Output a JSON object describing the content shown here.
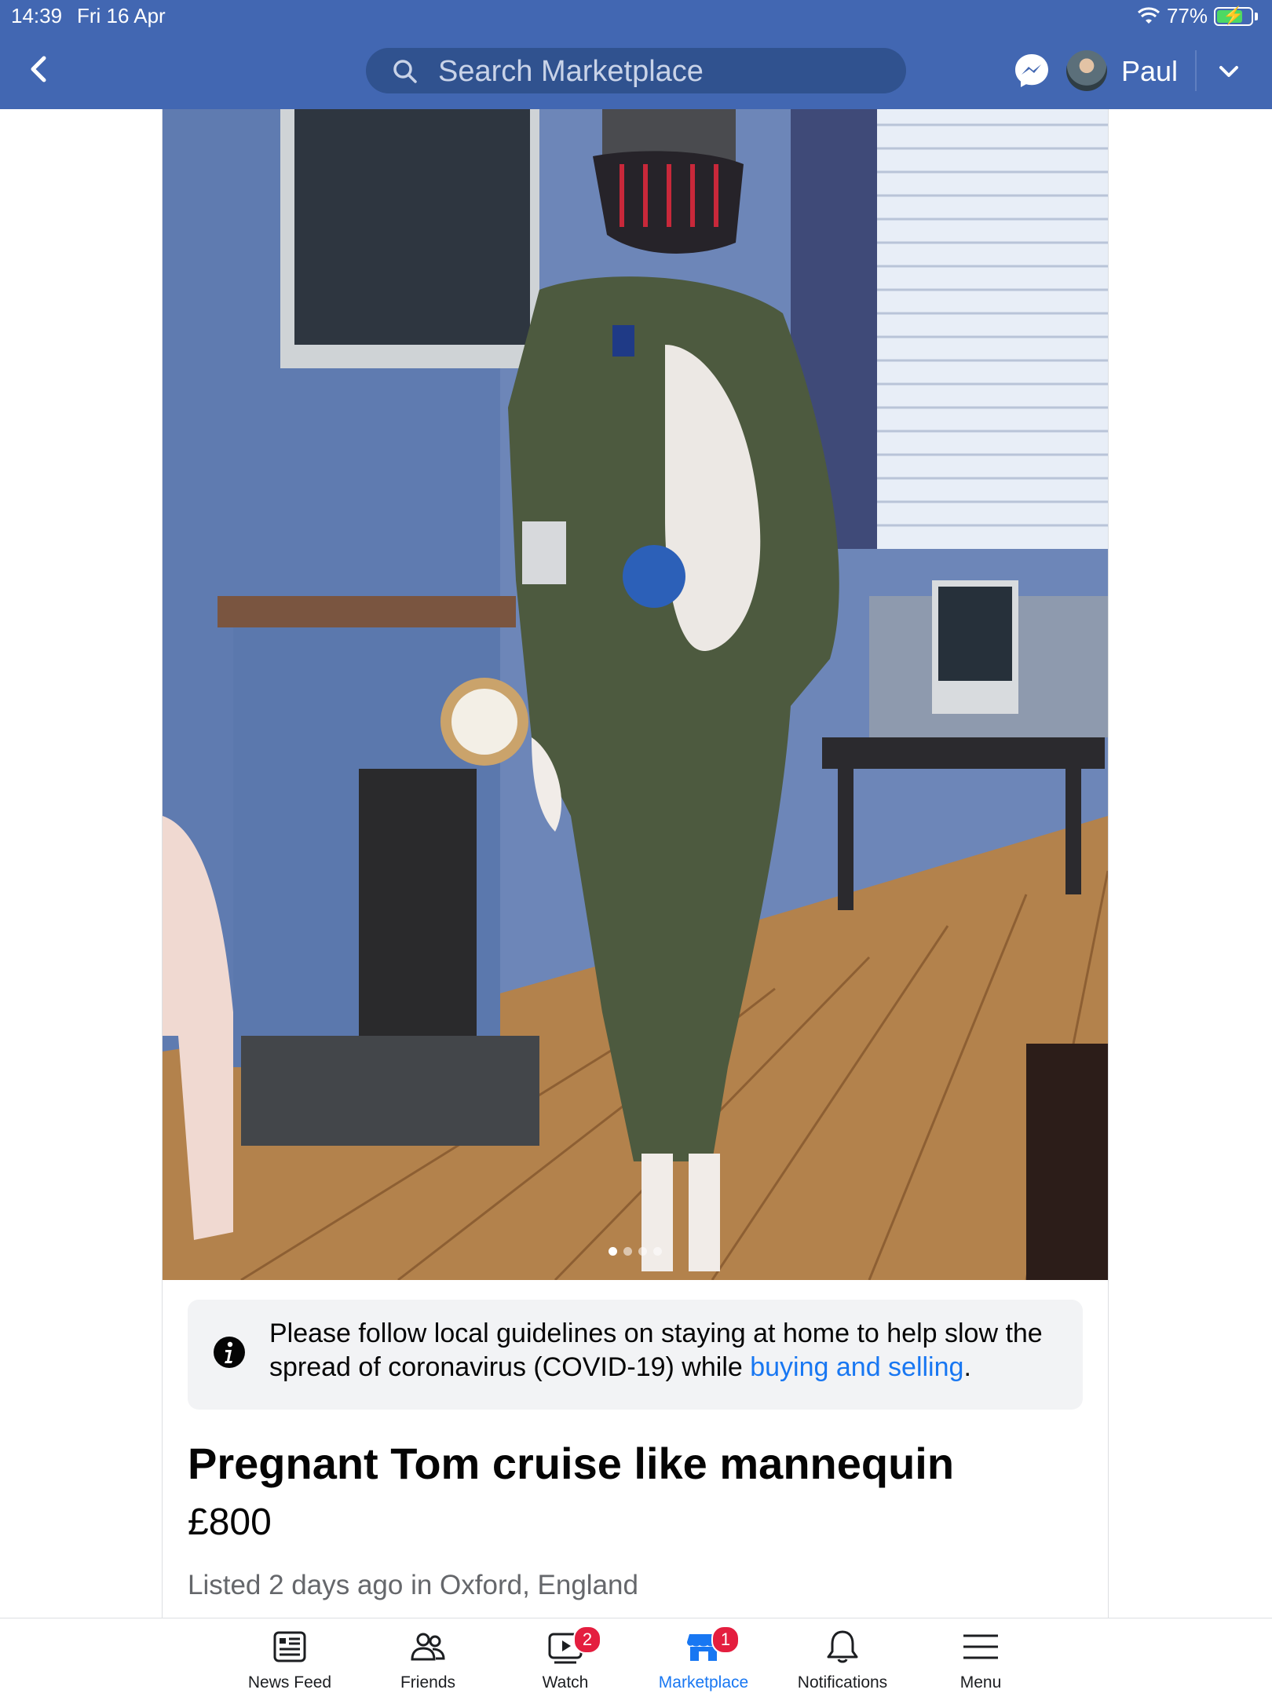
{
  "status_bar": {
    "time": "14:39",
    "date": "Fri 16 Apr",
    "battery": "77%",
    "battery_level": 0.77,
    "battery_color": "#4cd964"
  },
  "header": {
    "background_color": "#4267b2",
    "back_icon": "chevron-left-icon",
    "search": {
      "placeholder": "Search Marketplace",
      "value": "",
      "icon": "search-icon"
    },
    "messenger_icon": "messenger-icon",
    "user_name": "Paul",
    "account_menu_icon": "chevron-down-icon"
  },
  "listing": {
    "photo": {
      "description_icon": "listing-photo",
      "total_photos": 4,
      "current_photo": 1
    },
    "notice": {
      "icon": "info-icon",
      "text": "Please follow local guidelines on staying at home to help slow the spread of coronavirus (COVID-19) while ",
      "link": "buying and selling",
      "trailing": "."
    },
    "title": "Pregnant Tom cruise like mannequin",
    "price": "£800",
    "listed": "Listed 2 days ago in Oxford, England"
  },
  "tabbar": {
    "active_color": "#1877f2",
    "badge_color": "#e41e3f",
    "tabs": [
      {
        "label": "News Feed",
        "icon": "news-feed-icon"
      },
      {
        "label": "Friends",
        "icon": "friends-icon"
      },
      {
        "label": "Watch",
        "icon": "watch-icon",
        "badge": "2"
      },
      {
        "label": "Marketplace",
        "icon": "marketplace-icon",
        "badge": "1",
        "active": true
      },
      {
        "label": "Notifications",
        "icon": "bell-icon"
      },
      {
        "label": "Menu",
        "icon": "menu-icon"
      }
    ]
  }
}
